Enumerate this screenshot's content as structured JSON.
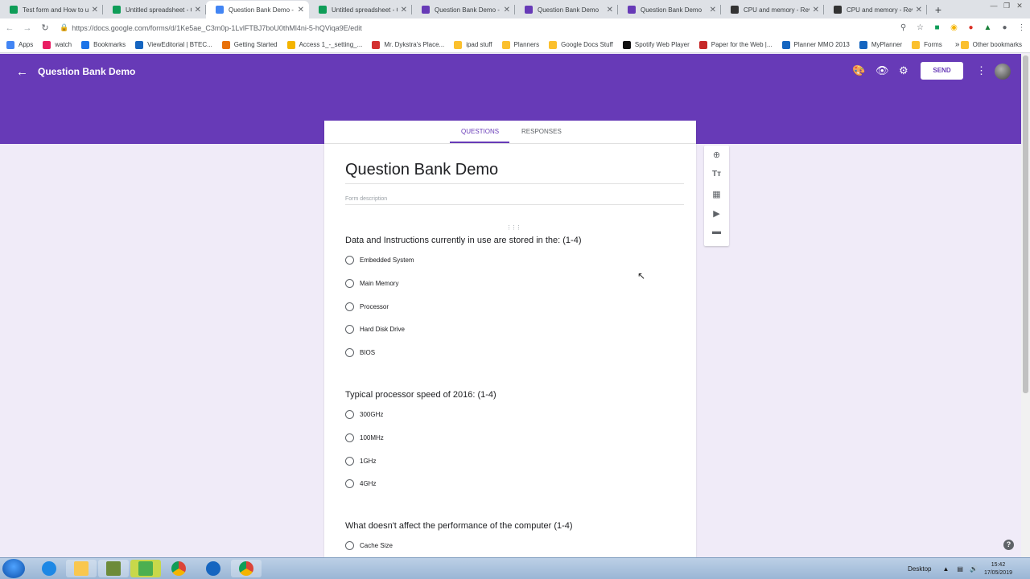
{
  "browser": {
    "tabs": [
      {
        "title": "Test form and How to u",
        "color": "#0f9d58",
        "active": false
      },
      {
        "title": "Untitled spreadsheet - G",
        "color": "#0f9d58",
        "active": false
      },
      {
        "title": "Question Bank Demo - G",
        "color": "#4285f4",
        "active": true
      },
      {
        "title": "Untitled spreadsheet - G",
        "color": "#0f9d58",
        "active": false
      },
      {
        "title": "Question Bank Demo - G",
        "color": "#673ab7",
        "active": false
      },
      {
        "title": "Question Bank Demo",
        "color": "#673ab7",
        "active": false
      },
      {
        "title": "Question Bank Demo",
        "color": "#673ab7",
        "active": false
      },
      {
        "title": "CPU and memory - Revi",
        "color": "#333333",
        "active": false
      },
      {
        "title": "CPU and memory - Revi",
        "color": "#333333",
        "active": false
      }
    ],
    "new_tab": "+",
    "url": "https://docs.google.com/forms/d/1Ke5ae_C3m0p-1LvlFTBJ7boU0thMl4ni-5-hQViqa9E/edit"
  },
  "bookmarks": {
    "items": [
      {
        "label": "Apps",
        "color": "#4285f4"
      },
      {
        "label": "watch",
        "color": "#e91e63"
      },
      {
        "label": "Bookmarks",
        "color": "#1a73e8"
      },
      {
        "label": "ViewEditorial | BTEC...",
        "color": "#1565c0"
      },
      {
        "label": "Getting Started",
        "color": "#e8710a"
      },
      {
        "label": "Access 1_-_setting_...",
        "color": "#f4b400"
      },
      {
        "label": "Mr. Dykstra's Place...",
        "color": "#d32f2f"
      },
      {
        "label": "ipad stuff",
        "color": "#fbc02d"
      },
      {
        "label": "Planners",
        "color": "#fbc02d"
      },
      {
        "label": "Google Docs Stuff",
        "color": "#fbc02d"
      },
      {
        "label": "Spotify Web Player",
        "color": "#111111"
      },
      {
        "label": "Paper for the Web |...",
        "color": "#c62828"
      },
      {
        "label": "Planner MMO 2013",
        "color": "#1565c0"
      },
      {
        "label": "MyPlanner",
        "color": "#1565c0"
      },
      {
        "label": "Forms",
        "color": "#fbc02d"
      }
    ],
    "more": "»",
    "other": "Other bookmarks"
  },
  "header": {
    "form_name": "Question Bank Demo",
    "send_label": "SEND",
    "bg_color": "#673ab7"
  },
  "form": {
    "tab_questions": "QUESTIONS",
    "tab_responses": "RESPONSES",
    "title": "Question Bank Demo",
    "description_placeholder": "Form description",
    "questions": [
      {
        "text": "Data and Instructions currently in use are stored in the: (1-4)",
        "options": [
          "Embedded System",
          "Main Memory",
          "Processor",
          "Hard Disk Drive",
          "BIOS"
        ]
      },
      {
        "text": "Typical processor speed of 2016: (1-4)",
        "options": [
          "300GHz",
          "100MHz",
          "1GHz",
          "4GHz"
        ]
      },
      {
        "text": "What doesn't affect the performance of the computer (1-4)",
        "options": [
          "Cache Size"
        ]
      }
    ]
  },
  "side_tools": [
    "add-question-icon",
    "add-title-icon",
    "add-image-icon",
    "add-video-icon",
    "add-section-icon"
  ],
  "taskbar": {
    "desktop_label": "Desktop",
    "time": "15:42",
    "date": "17/05/2019"
  }
}
